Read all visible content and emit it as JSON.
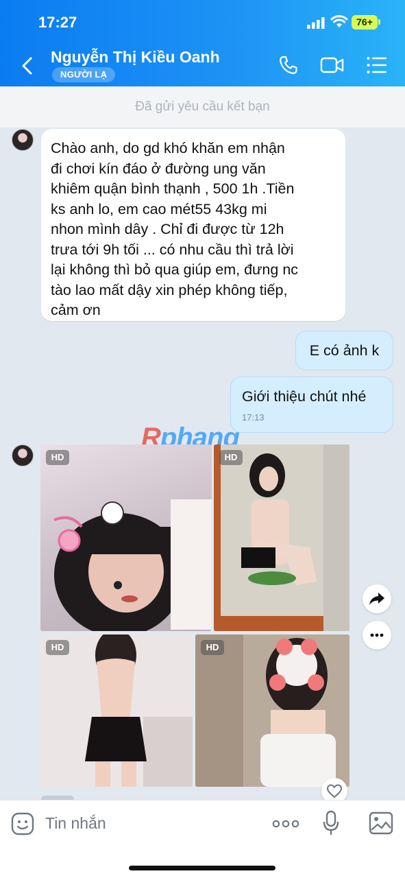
{
  "status_bar": {
    "time": "17:27",
    "battery": "76+"
  },
  "header": {
    "contact_name": "Nguyễn Thị Kiều Oanh",
    "badge": "NGƯỜI LẠ"
  },
  "notice": "Đã gửi yêu cầu kết bạn",
  "messages": {
    "incoming_text": [
      "Chào anh,  do gd khó khăn em nhận",
      "đi chơi kín đáo ở đường ung văn",
      "khiêm quận bình thạnh , 500 1h .Tiền",
      "ks anh lo, em cao mét55 43kg mi",
      "nhon mình dây . Chỉ đi được từ 12h",
      "trưa tới 9h tối ... có nhu cầu thì trả lời",
      "lại không thì bỏ qua giúp em, đưng nc",
      "tào lao mất dậy xin phép không tiếp,",
      "cảm ơn"
    ],
    "outgoing_1": "E có ảnh k",
    "outgoing_2": "Giới thiệu chút nhé",
    "outgoing_2_time": "17:13"
  },
  "watermark": {
    "left": "R",
    "right": "phang"
  },
  "photos": {
    "badge": "HD"
  },
  "composer": {
    "placeholder": "Tin nhắn"
  },
  "colors": {
    "header_start": "#0a7cf2",
    "header_end": "#2ab3f7",
    "outgoing_bubble": "#d4eefe",
    "chat_background": "#e2e8ef"
  },
  "icons": [
    "back-chevron-icon",
    "phone-icon",
    "video-call-icon",
    "menu-list-icon",
    "forward-icon",
    "more-icon",
    "heart-icon",
    "sticker-icon",
    "ellipsis-icon",
    "microphone-icon",
    "image-icon"
  ]
}
